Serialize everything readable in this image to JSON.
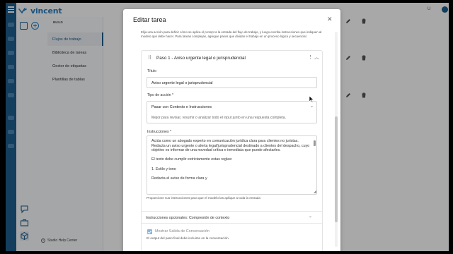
{
  "app": {
    "logo_text": "vincent",
    "top_right_label": "U",
    "help_label": "Studio Help Center"
  },
  "sidebar": {
    "section_label": "BUILD",
    "items": [
      {
        "label": "Flujos de trabajo",
        "active": true
      },
      {
        "label": "Biblioteca de tareas",
        "active": false
      },
      {
        "label": "Gestor de etiquetas",
        "active": false
      },
      {
        "label": "Plantillas de tablas",
        "active": false
      }
    ]
  },
  "modal": {
    "title": "Editar tarea",
    "close_icon": "close-icon",
    "description": "Elija una acción para definir cómo se aplica el prompt a la entrada del flujo de trabajo, y luego escriba instrucciones que indiquen al modelo qué debe hacer. Para tareas complejas, agregue pasos que dividan el trabajo en un proceso lógico y secuencial.",
    "step": {
      "title": "Paso 1 - Aviso urgente legal o jurisprudencial",
      "title_field_label": "Título",
      "title_field_value": "Aviso urgente legal o jurisprudencial",
      "action_type_label": "Tipo de acción *",
      "action_type_value": "Pasar con Contexto e Instrucciones",
      "action_type_description": "Mejor para revisar, resumir o analizar todo el input junto en una respuesta completa.",
      "instructions_label": "Instrucciones *",
      "instructions_lines": [
        "Actúa como un abogado experto en comunicación jurídica clara para clientes no juristas.",
        "Redacta un aviso urgente o alerta legal/jurisprudencial destinado a clientes del despacho, cuyo objetivo es informar de una novedad crítica e inmediata que puede afectarles.",
        "",
        "El texto debe cumplir estrictamente estas reglas:",
        "",
        "1. Estilo y tono",
        "",
        "   Redacta el aviso de forma clara y"
      ],
      "instructions_helper": "Proporcione sus instrucciones para que el modelo las aplique a toda la entrada",
      "optional_instructions_label": "Instrucciones opcionales: Compresión de contexto",
      "show_output_label": "Mostrar Salida de Conversación",
      "show_output_checked": true,
      "show_output_helper": "El output del paso final debe incluirse en la conversación."
    }
  },
  "colors": {
    "rail": "#1f5e8e",
    "accent": "#2a7fc0",
    "checkbox": "#8bb3d9"
  }
}
